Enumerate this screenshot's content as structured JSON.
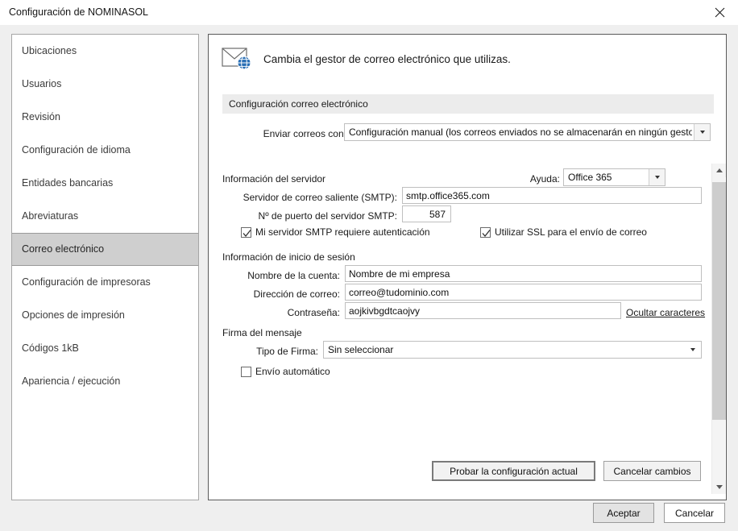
{
  "window": {
    "title": "Configuración de NOMINASOL",
    "close_icon": "close-icon"
  },
  "sidebar": {
    "items": [
      {
        "label": "Ubicaciones",
        "selected": false
      },
      {
        "label": "Usuarios",
        "selected": false
      },
      {
        "label": "Revisión",
        "selected": false
      },
      {
        "label": "Configuración de idioma",
        "selected": false
      },
      {
        "label": "Entidades bancarias",
        "selected": false
      },
      {
        "label": "Abreviaturas",
        "selected": false
      },
      {
        "label": "Correo electrónico",
        "selected": true
      },
      {
        "label": "Configuración de impresoras",
        "selected": false
      },
      {
        "label": "Opciones de impresión",
        "selected": false
      },
      {
        "label": "Códigos 1kB",
        "selected": false
      },
      {
        "label": "Apariencia / ejecución",
        "selected": false
      }
    ]
  },
  "panel": {
    "header_icon": "email-globe-icon",
    "header_text": "Cambia el gestor de correo electrónico que utilizas.",
    "band_title": "Configuración correo electrónico",
    "send_with": {
      "label": "Enviar correos con:",
      "value": "Configuración manual (los correos enviados no se almacenarán en ningún gestor d"
    },
    "server_section": {
      "title": "Información del servidor",
      "help_label": "Ayuda:",
      "help_value": "Office 365",
      "smtp_label": "Servidor de correo saliente (SMTP):",
      "smtp_value": "smtp.office365.com",
      "port_label": "Nº de puerto del servidor SMTP:",
      "port_value": "587",
      "auth_checkbox": "Mi servidor SMTP requiere autenticación",
      "auth_checked": true,
      "ssl_checkbox": "Utilizar SSL para el envío de correo",
      "ssl_checked": true
    },
    "login_section": {
      "title": "Información de inicio de sesión",
      "account_label": "Nombre de la cuenta:",
      "account_value": "Nombre de mi empresa",
      "email_label": "Dirección de correo:",
      "email_value": "correo@tudominio.com",
      "password_label": "Contraseña:",
      "password_value": "aojkivbgdtcaojvy",
      "toggle_link": "Ocultar caracteres"
    },
    "signature_section": {
      "title": "Firma del mensaje",
      "type_label": "Tipo de Firma:",
      "type_value": "Sin seleccionar",
      "auto_checkbox": "Envío automático",
      "auto_checked": false
    },
    "test_button": "Probar la configuración actual",
    "cancel_changes_button": "Cancelar cambios"
  },
  "footer": {
    "accept_button": "Aceptar",
    "cancel_button": "Cancelar"
  },
  "colors": {
    "accent_blue": "#2a6fb5",
    "selection_gray": "#cfcfcf",
    "band_gray": "#ececec"
  }
}
